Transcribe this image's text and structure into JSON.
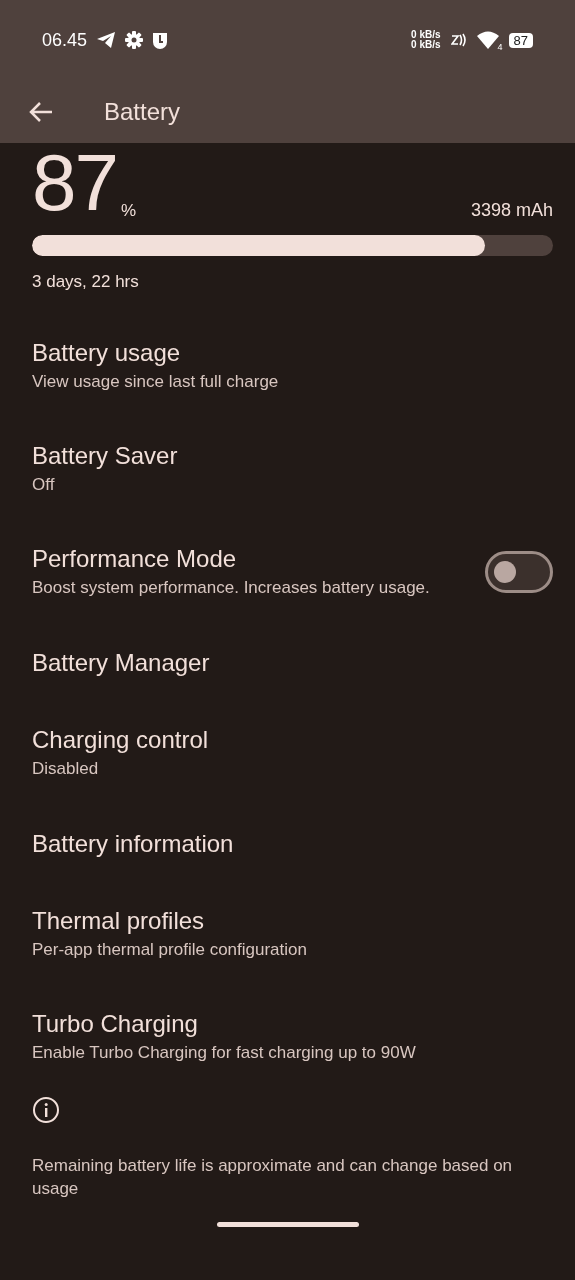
{
  "status_bar": {
    "time": "06.45",
    "net_up": "0 kB/s",
    "net_down": "0 kB/s",
    "wifi_badge": "4",
    "battery": "87"
  },
  "app_bar": {
    "title": "Battery"
  },
  "summary": {
    "percent": "87",
    "unit": "%",
    "capacity": "3398 mAh",
    "level": 0.87,
    "remaining": "3 days, 22 hrs"
  },
  "items": [
    {
      "kind": "text",
      "title": "Battery usage",
      "subtitle": "View usage since last full charge"
    },
    {
      "kind": "text",
      "title": "Battery Saver",
      "subtitle": "Off"
    },
    {
      "kind": "switch",
      "title": "Performance Mode",
      "subtitle": "Boost system performance. Increases battery usage.",
      "on": false
    },
    {
      "kind": "text",
      "title": "Battery Manager"
    },
    {
      "kind": "text",
      "title": "Charging control",
      "subtitle": "Disabled"
    },
    {
      "kind": "text",
      "title": "Battery information"
    },
    {
      "kind": "text",
      "title": "Thermal profiles",
      "subtitle": "Per-app thermal profile configuration"
    },
    {
      "kind": "text",
      "title": "Turbo Charging",
      "subtitle": "Enable Turbo Charging for fast charging up to 90W"
    }
  ],
  "footer": {
    "note": "Remaining battery life is approximate and can change based on usage"
  }
}
